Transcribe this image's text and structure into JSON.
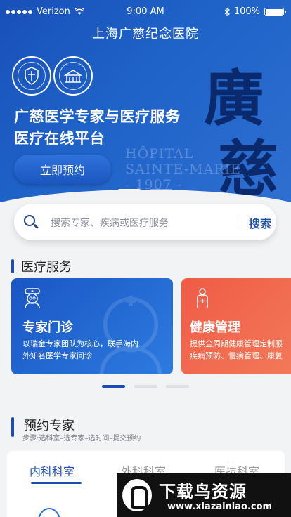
{
  "status_bar": {
    "carrier": "Verizon",
    "time": "9:00 AM",
    "battery": "100%"
  },
  "header": {
    "title": "上海广慈纪念医院"
  },
  "hero": {
    "line1": "广慈医学专家与医疗服务",
    "line2": "医疗在线平台",
    "book_button": "立即预约",
    "watermark_line1": "HÔPITAL",
    "watermark_line2": "SAINTE-MARIE",
    "watermark_line3": "- 1907 -",
    "watermark_chars": [
      "廣",
      "慈"
    ]
  },
  "search": {
    "placeholder": "搜索专家、疾病或医疗服务",
    "button": "搜索"
  },
  "services": {
    "title": "医疗服务",
    "cards": [
      {
        "title": "专家门诊",
        "desc_line1": "以瑞金专家团队为核心，联手海内",
        "desc_line2": "外知名医学专家问诊",
        "icon": "doctor-icon",
        "color": "#1f5fce"
      },
      {
        "title": "健康管理",
        "desc_line1": "提供全周期健康管理定制服",
        "desc_line2": "疾病预防、慢病管理、康复",
        "icon": "person-health-icon",
        "color": "#f26248"
      }
    ]
  },
  "experts": {
    "title": "预约专家",
    "steps": "步骤:选科室–选专家–选时间–提交预约",
    "tabs": [
      "内科科室",
      "外科科室",
      "医技科室"
    ],
    "active_tab": 0
  },
  "badge": {
    "main": "下载鸟资源",
    "url": "www.xiazainiao.com"
  },
  "colors": {
    "primary": "#1b4fb5",
    "accent": "#f26248"
  }
}
